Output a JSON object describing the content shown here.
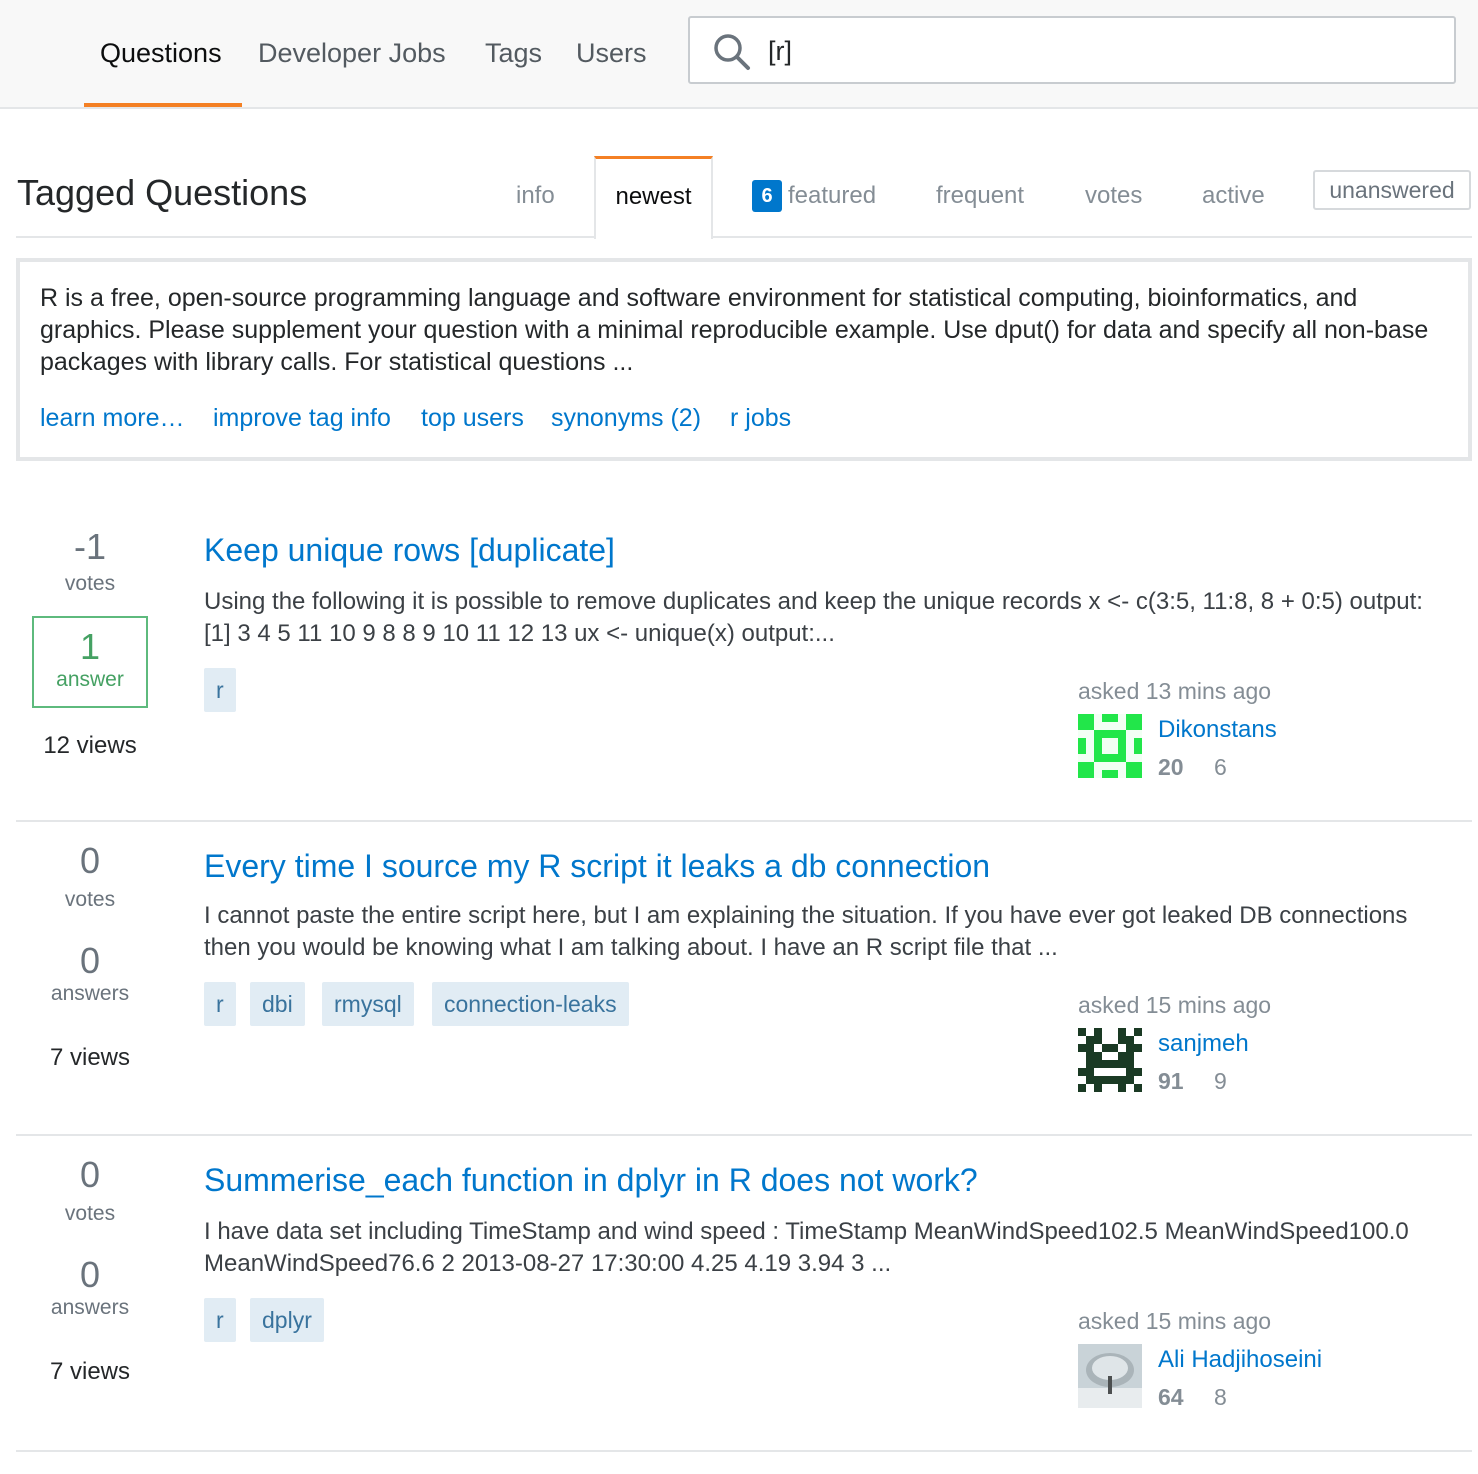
{
  "nav": {
    "items": [
      {
        "label": "Questions",
        "active": true
      },
      {
        "label": "Developer Jobs",
        "active": false
      },
      {
        "label": "Tags",
        "active": false
      },
      {
        "label": "Users",
        "active": false
      }
    ],
    "search_value": "[r]",
    "accent_color": "#f48024"
  },
  "page": {
    "title": "Tagged Questions",
    "tabs": {
      "info": "info",
      "newest": "newest",
      "featured_count": "6",
      "featured": "featured",
      "frequent": "frequent",
      "votes": "votes",
      "active": "active",
      "unanswered": "unanswered"
    },
    "active_tab": "newest"
  },
  "tag_wiki": {
    "excerpt": "R is a free, open-source programming language and software environment for statistical computing, bioinformatics, and graphics. Please supplement your question with a minimal reproducible example. Use dput() for data and specify all non-base packages with library calls. For statistical questions ...",
    "links": {
      "learn_more": "learn more…",
      "improve": "improve tag info",
      "top_users": "top users",
      "synonyms": "synonyms (2)",
      "jobs": "r jobs"
    }
  },
  "questions": [
    {
      "votes": "-1",
      "votes_label": "votes",
      "answers": "1",
      "answers_label": "answer",
      "accepted_style": true,
      "views": "12 views",
      "title": "Keep unique rows [duplicate]",
      "excerpt": "Using the following it is possible to remove duplicates and keep the unique records x <- c(3:5, 11:8, 8 + 0:5) output: [1] 3 4 5 11 10 9 8 8 9 10 11 12 13 ux <- unique(x) output:...",
      "tags": [
        "r"
      ],
      "asked": "asked 13 mins ago",
      "user": "Dikonstans",
      "rep": "20",
      "badges": "6",
      "avatar": "green-identicon"
    },
    {
      "votes": "0",
      "votes_label": "votes",
      "answers": "0",
      "answers_label": "answers",
      "accepted_style": false,
      "views": "7 views",
      "title": "Every time I source my R script it leaks a db connection",
      "excerpt": "I cannot paste the entire script here, but I am explaining the situation. If you have ever got leaked DB connections then you would be knowing what I am talking about. I have an R script file that ...",
      "tags": [
        "r",
        "dbi",
        "rmysql",
        "connection-leaks"
      ],
      "asked": "asked 15 mins ago",
      "user": "sanjmeh",
      "rep": "91",
      "badges": "9",
      "avatar": "dark-green-identicon"
    },
    {
      "votes": "0",
      "votes_label": "votes",
      "answers": "0",
      "answers_label": "answers",
      "accepted_style": false,
      "views": "7 views",
      "title": "Summerise_each function in dplyr in R does not work?",
      "excerpt": "I have data set including TimeStamp and wind speed : TimeStamp MeanWindSpeed102.5 MeanWindSpeed100.0 MeanWindSpeed76.6 2 2013-08-27 17:30:00 4.25 4.19 3.94 3 ...",
      "tags": [
        "r",
        "dplyr"
      ],
      "asked": "asked 15 mins ago",
      "user": "Ali Hadjihoseini",
      "rep": "64",
      "badges": "8",
      "avatar": "tree-photo"
    }
  ]
}
